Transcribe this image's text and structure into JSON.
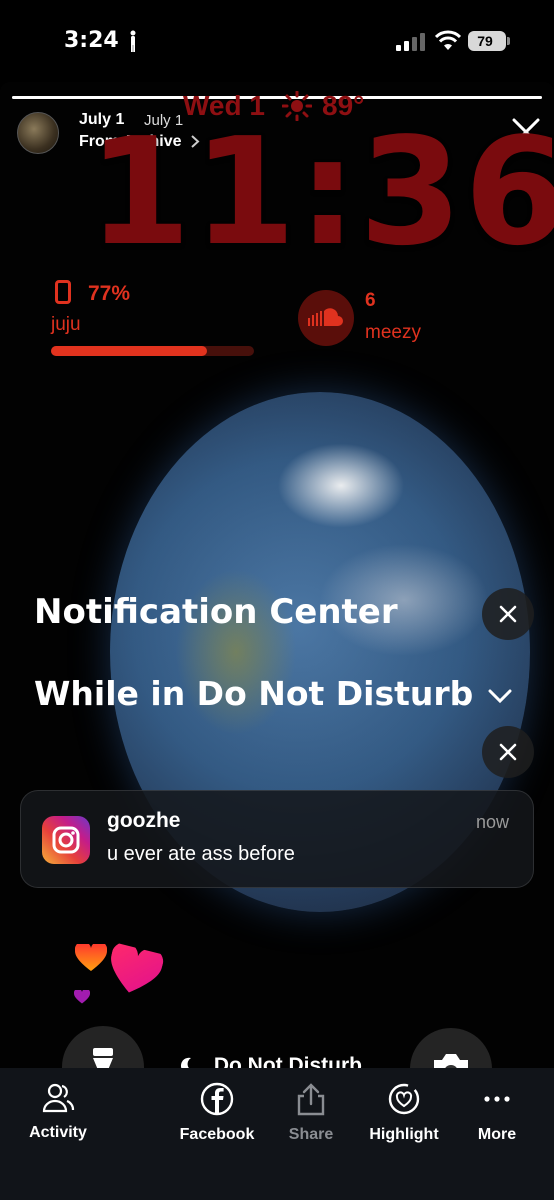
{
  "status_bar": {
    "time": "3:24",
    "battery": "79"
  },
  "story": {
    "progress_fraction": 1.0,
    "date": "July 1",
    "date_secondary": "July 1",
    "source": "From Archive",
    "lock_screen": {
      "date": "Wed 1",
      "temperature": "89°",
      "time": "11:36",
      "widget_battery": {
        "percent_label": "77%",
        "name": "juju",
        "level": 0.77
      },
      "widget_soundcloud": {
        "count": "6",
        "name": "meezy"
      },
      "notification_center": "Notification Center",
      "dnd_header": "While in Do Not Disturb",
      "notification": {
        "app": "goozhe",
        "time": "now",
        "message": "u ever ate ass before"
      },
      "bottom_mode": "Do Not Disturb"
    }
  },
  "bottom_bar": {
    "items": [
      {
        "label": "Activity",
        "icon": "people-icon"
      },
      {
        "label": "Facebook",
        "icon": "facebook-icon"
      },
      {
        "label": "Share",
        "icon": "share-icon"
      },
      {
        "label": "Highlight",
        "icon": "highlight-heart-icon"
      },
      {
        "label": "More",
        "icon": "more-dots-icon"
      }
    ]
  },
  "colors": {
    "lock_red": "#8e0f12",
    "widget_red": "#e0321f",
    "bar_bg": "#111419"
  }
}
